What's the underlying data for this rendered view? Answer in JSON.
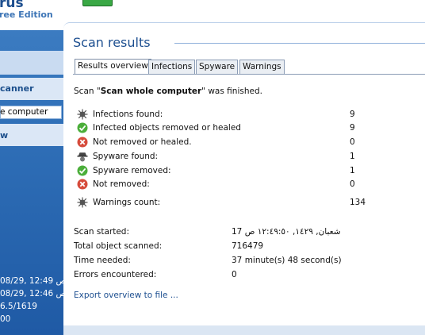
{
  "sidebar": {
    "brand_name": "rus",
    "brand_edition": "ree Edition",
    "scanner_label": "canner",
    "target_label": "e computer",
    "view_label": "w",
    "info_lines": [
      "08/29, 12:49 ص",
      "08/29, 12:46 ص",
      "6.5/1619",
      "00"
    ]
  },
  "panel": {
    "title": "Scan results",
    "tabs": [
      "Results overview",
      "Infections",
      "Spyware",
      "Warnings"
    ],
    "active_tab": "Results overview",
    "scan_msg_prefix": "Scan \"",
    "scan_msg_target": "Scan whole computer",
    "scan_msg_suffix": "\" was finished.",
    "results": [
      {
        "icon": "virus-icon",
        "label": "Infections found:",
        "value": "9"
      },
      {
        "icon": "check-icon",
        "label": "Infected objects removed or healed",
        "value": "9"
      },
      {
        "icon": "error-icon",
        "label": "Not removed or healed.",
        "value": "0"
      },
      {
        "icon": "spy-icon",
        "label": "Spyware found:",
        "value": "1"
      },
      {
        "icon": "check-icon",
        "label": "Spyware removed:",
        "value": "1"
      },
      {
        "icon": "error-icon",
        "label": "Not removed:",
        "value": "0"
      },
      {
        "icon": "warning-icon",
        "label": "Warnings count:",
        "value": "134"
      }
    ],
    "info": [
      {
        "label": "Scan started:",
        "value": "شعبان, ١٤٢٩, ١٢:٤٩:٥٠ ص 17"
      },
      {
        "label": "Total object scanned:",
        "value": "716479"
      },
      {
        "label": "Time needed:",
        "value": "37 minute(s) 48 second(s)"
      },
      {
        "label": "Errors encountered:",
        "value": "0"
      }
    ],
    "export_link": "Export overview to file ..."
  },
  "colors": {
    "accent": "#1d4f90",
    "sidebar": "#2f6fb7"
  }
}
